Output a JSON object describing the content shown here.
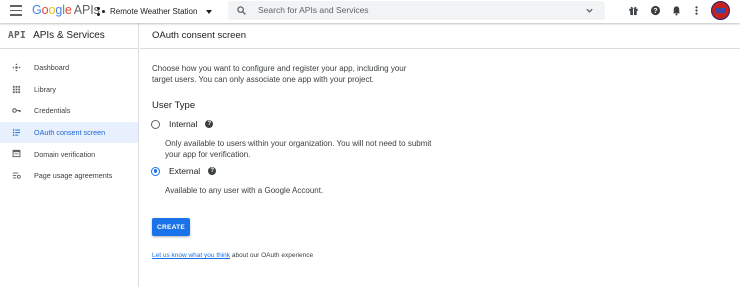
{
  "topbar": {
    "logo_google": "Google",
    "logo_apis": "APIs",
    "project_name": "Remote Weather Station",
    "search_placeholder": "Search for APIs and Services",
    "icons": [
      "menu-icon",
      "project-icon",
      "dropdown-caret-icon",
      "search-icon",
      "chevron-down-icon",
      "gift-icon",
      "help-icon",
      "notifications-icon",
      "more-vert-icon",
      "avatar"
    ]
  },
  "sidebar": {
    "badge": "API",
    "title": "APIs & Services",
    "items": [
      {
        "label": "Dashboard",
        "icon": "dashboard-icon"
      },
      {
        "label": "Library",
        "icon": "library-icon"
      },
      {
        "label": "Credentials",
        "icon": "key-icon"
      },
      {
        "label": "OAuth consent screen",
        "icon": "consent-icon",
        "active": true
      },
      {
        "label": "Domain verification",
        "icon": "domain-icon"
      },
      {
        "label": "Page usage agreements",
        "icon": "settings-list-icon"
      }
    ]
  },
  "main": {
    "title": "OAuth consent screen",
    "intro": "Choose how you want to configure and register your app, including your target users. You can only associate one app with your project.",
    "section_label": "User Type",
    "options": [
      {
        "label": "Internal",
        "checked": false,
        "description": "Only available to users within your organization. You will not need to submit your app for verification."
      },
      {
        "label": "External",
        "checked": true,
        "description": "Available to any user with a Google Account."
      }
    ],
    "create_label": "CREATE",
    "feedback_link": "Let us know what you think",
    "feedback_rest": " about our OAuth experience"
  },
  "colors": {
    "accent": "#1a73e8",
    "active_bg": "#e8f0fe",
    "active_text": "#1967d2"
  }
}
